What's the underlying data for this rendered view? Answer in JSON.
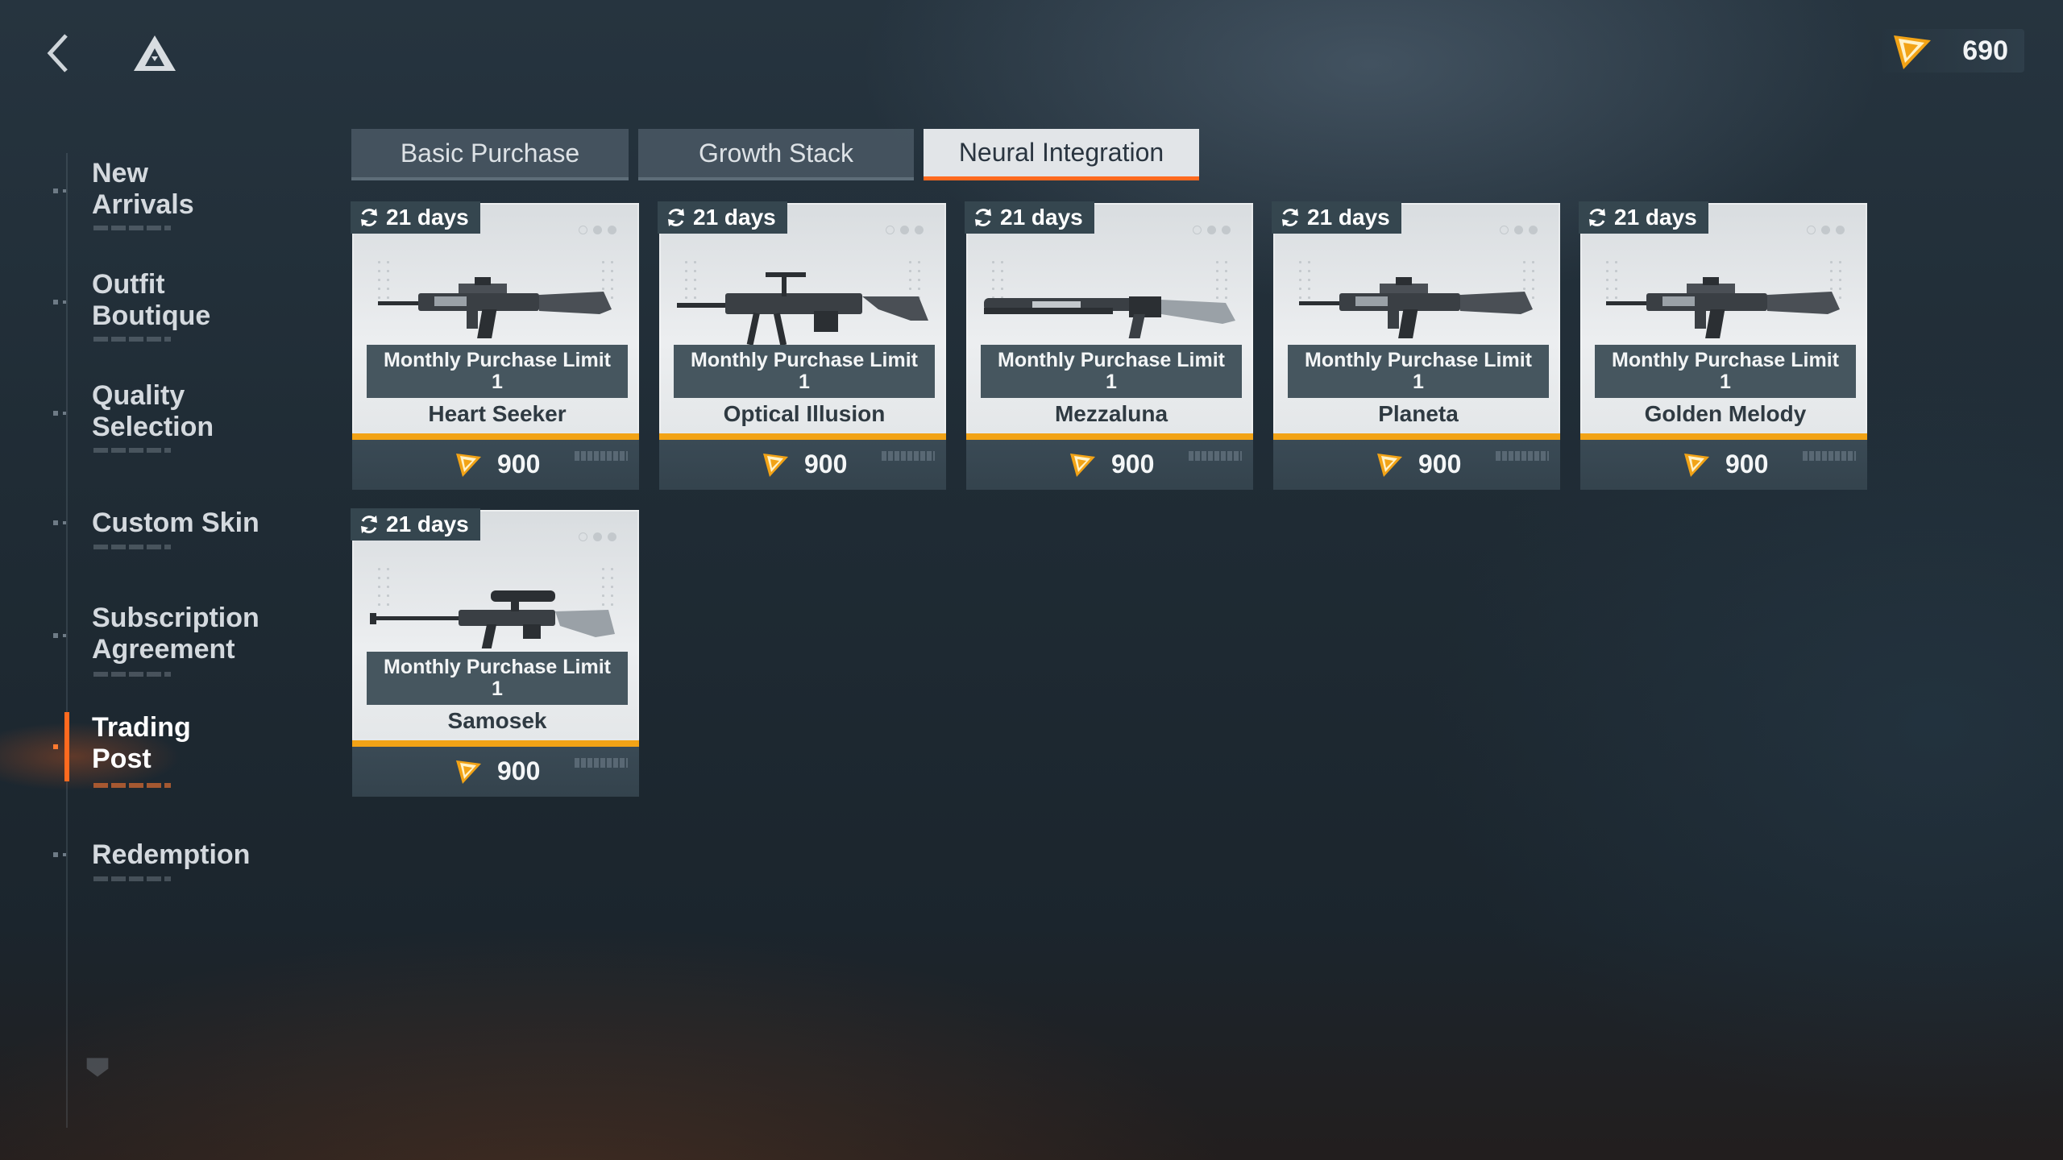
{
  "header": {
    "back_icon": "chevron-left-icon",
    "logo_icon": "triangle-logo-icon",
    "currency": {
      "icon": "currency-triangle-icon",
      "amount": "690",
      "color": "#f2a316"
    }
  },
  "sidebar": {
    "items": [
      {
        "label": "New\nArrivals",
        "active": false
      },
      {
        "label": "Outfit\nBoutique",
        "active": false
      },
      {
        "label": "Quality\nSelection",
        "active": false
      },
      {
        "label": "Custom Skin",
        "active": false
      },
      {
        "label": "Subscription\nAgreement",
        "active": false
      },
      {
        "label": "Trading\nPost",
        "active": true
      },
      {
        "label": "Redemption",
        "active": false
      }
    ],
    "accent_color": "#ff6a1f"
  },
  "tabs": [
    {
      "label": "Basic Purchase",
      "selected": false
    },
    {
      "label": "Growth Stack",
      "selected": false
    },
    {
      "label": "Neural Integration",
      "selected": true
    }
  ],
  "products": [
    {
      "badge": "21 days",
      "limit_label": "Monthly Purchase Limit",
      "limit_value": "1",
      "name": "Heart Seeker",
      "price": "900",
      "weapon_icon": "assault-rifle-icon"
    },
    {
      "badge": "21 days",
      "limit_label": "Monthly Purchase Limit",
      "limit_value": "1",
      "name": "Optical Illusion",
      "price": "900",
      "weapon_icon": "machine-gun-icon"
    },
    {
      "badge": "21 days",
      "limit_label": "Monthly Purchase Limit",
      "limit_value": "1",
      "name": "Mezzaluna",
      "price": "900",
      "weapon_icon": "shotgun-icon"
    },
    {
      "badge": "21 days",
      "limit_label": "Monthly Purchase Limit",
      "limit_value": "1",
      "name": "Planeta",
      "price": "900",
      "weapon_icon": "assault-rifle-icon"
    },
    {
      "badge": "21 days",
      "limit_label": "Monthly Purchase Limit",
      "limit_value": "1",
      "name": "Golden Melody",
      "price": "900",
      "weapon_icon": "assault-rifle-icon"
    },
    {
      "badge": "21 days",
      "limit_label": "Monthly Purchase Limit",
      "limit_value": "1",
      "name": "Samosek",
      "price": "900",
      "weapon_icon": "sniper-rifle-icon"
    }
  ]
}
